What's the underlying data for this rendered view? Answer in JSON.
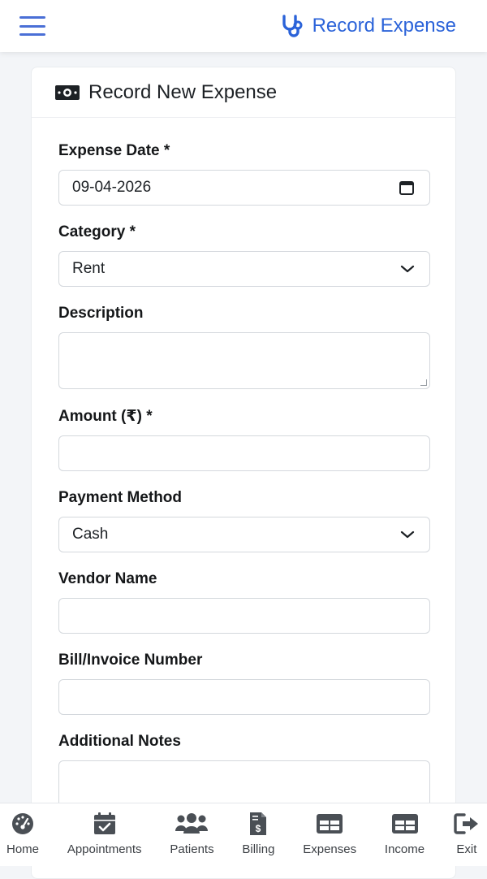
{
  "header": {
    "title": "Record Expense",
    "brand_icon": "stethoscope-icon",
    "menu_icon": "hamburger-menu-icon"
  },
  "form": {
    "title": "Record New Expense",
    "title_icon": "money-bill-icon",
    "fields": {
      "expense_date": {
        "label": "Expense Date *",
        "value": "09-04-2026"
      },
      "category": {
        "label": "Category *",
        "value": "Rent"
      },
      "description": {
        "label": "Description",
        "value": ""
      },
      "amount": {
        "label": "Amount (₹) *",
        "value": ""
      },
      "payment_method": {
        "label": "Payment Method",
        "value": "Cash"
      },
      "vendor_name": {
        "label": "Vendor Name",
        "value": ""
      },
      "bill_number": {
        "label": "Bill/Invoice Number",
        "value": ""
      },
      "notes": {
        "label": "Additional Notes",
        "value": ""
      }
    }
  },
  "nav": {
    "items": [
      {
        "label": "Home",
        "icon": "dashboard-gauge-icon"
      },
      {
        "label": "Appointments",
        "icon": "calendar-check-icon"
      },
      {
        "label": "Patients",
        "icon": "users-icon"
      },
      {
        "label": "Billing",
        "icon": "invoice-dollar-icon"
      },
      {
        "label": "Expenses",
        "icon": "table-icon"
      },
      {
        "label": "Income",
        "icon": "table-icon"
      },
      {
        "label": "Exit",
        "icon": "sign-out-icon"
      }
    ]
  },
  "colors": {
    "accent": "#2b63d9",
    "menu": "#4a6fd6",
    "icon_gray": "#4a4f55"
  }
}
